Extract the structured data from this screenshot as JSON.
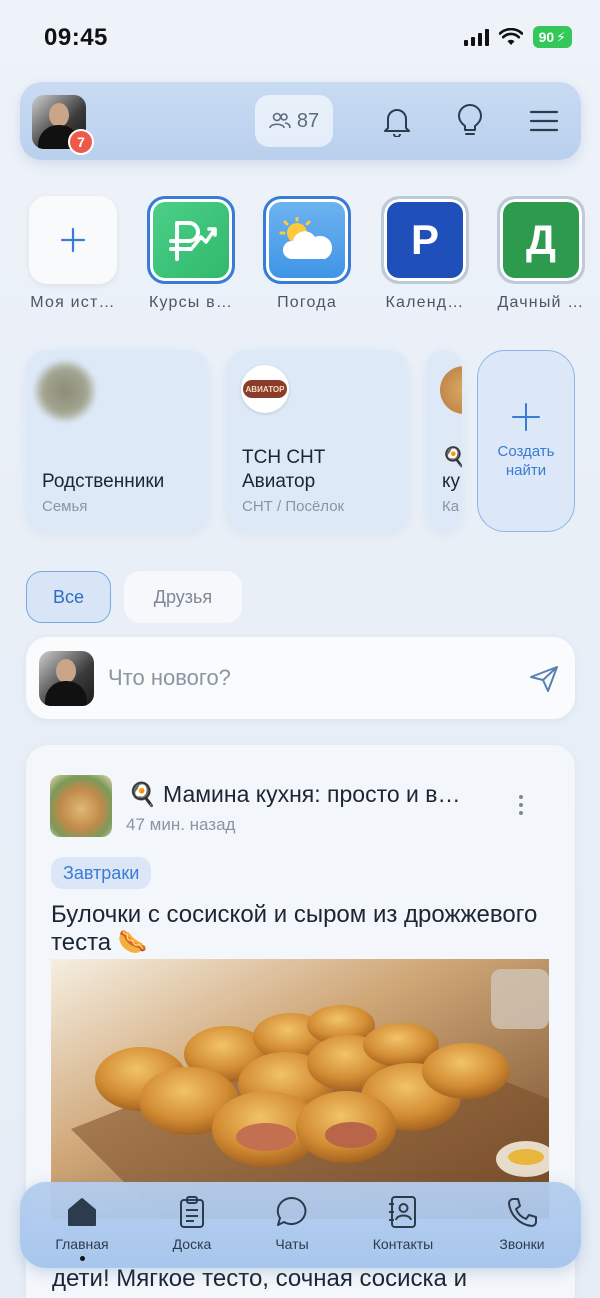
{
  "status_bar": {
    "time": "09:45",
    "battery": "90"
  },
  "top_bar": {
    "avatar_badge": "7",
    "friends_count": "87"
  },
  "stories": [
    {
      "label": "Моя ист…",
      "icon": "plus-icon"
    },
    {
      "label": "Курсы в…",
      "icon": "ruble-chart-icon"
    },
    {
      "label": "Погода",
      "icon": "weather-icon"
    },
    {
      "label": "Календ…",
      "letter": "Р",
      "color": "#1f4fb8"
    },
    {
      "label": "Дачный …",
      "letter": "Д",
      "color": "#2e9a4e"
    }
  ],
  "communities": [
    {
      "title": "Родственники",
      "subtitle": "Семья"
    },
    {
      "title_line1": "ТСН СНТ",
      "title_line2": "Авиатор",
      "subtitle": "СНТ / Посёлок",
      "logo_text": "АВИАТОР"
    },
    {
      "title_line1": "🍳",
      "title_line2": "ку",
      "subtitle": "Ка"
    }
  ],
  "create_card": {
    "line1": "Создать",
    "line2": "найти"
  },
  "tabs": {
    "all": "Все",
    "friends": "Друзья"
  },
  "composer": {
    "placeholder": "Что нового?"
  },
  "post": {
    "author": "🍳 Мамина кухня: просто и в…",
    "time": "47 мин. назад",
    "tag": "Завтраки",
    "title": "Булочки с сосиской и сыром из дрожжевого теста 🌭",
    "text": "дети! Мягкое тесто, сочная сосиска и"
  },
  "nav": {
    "home": "Главная",
    "board": "Доска",
    "chats": "Чаты",
    "contacts": "Контакты",
    "calls": "Звонки"
  }
}
